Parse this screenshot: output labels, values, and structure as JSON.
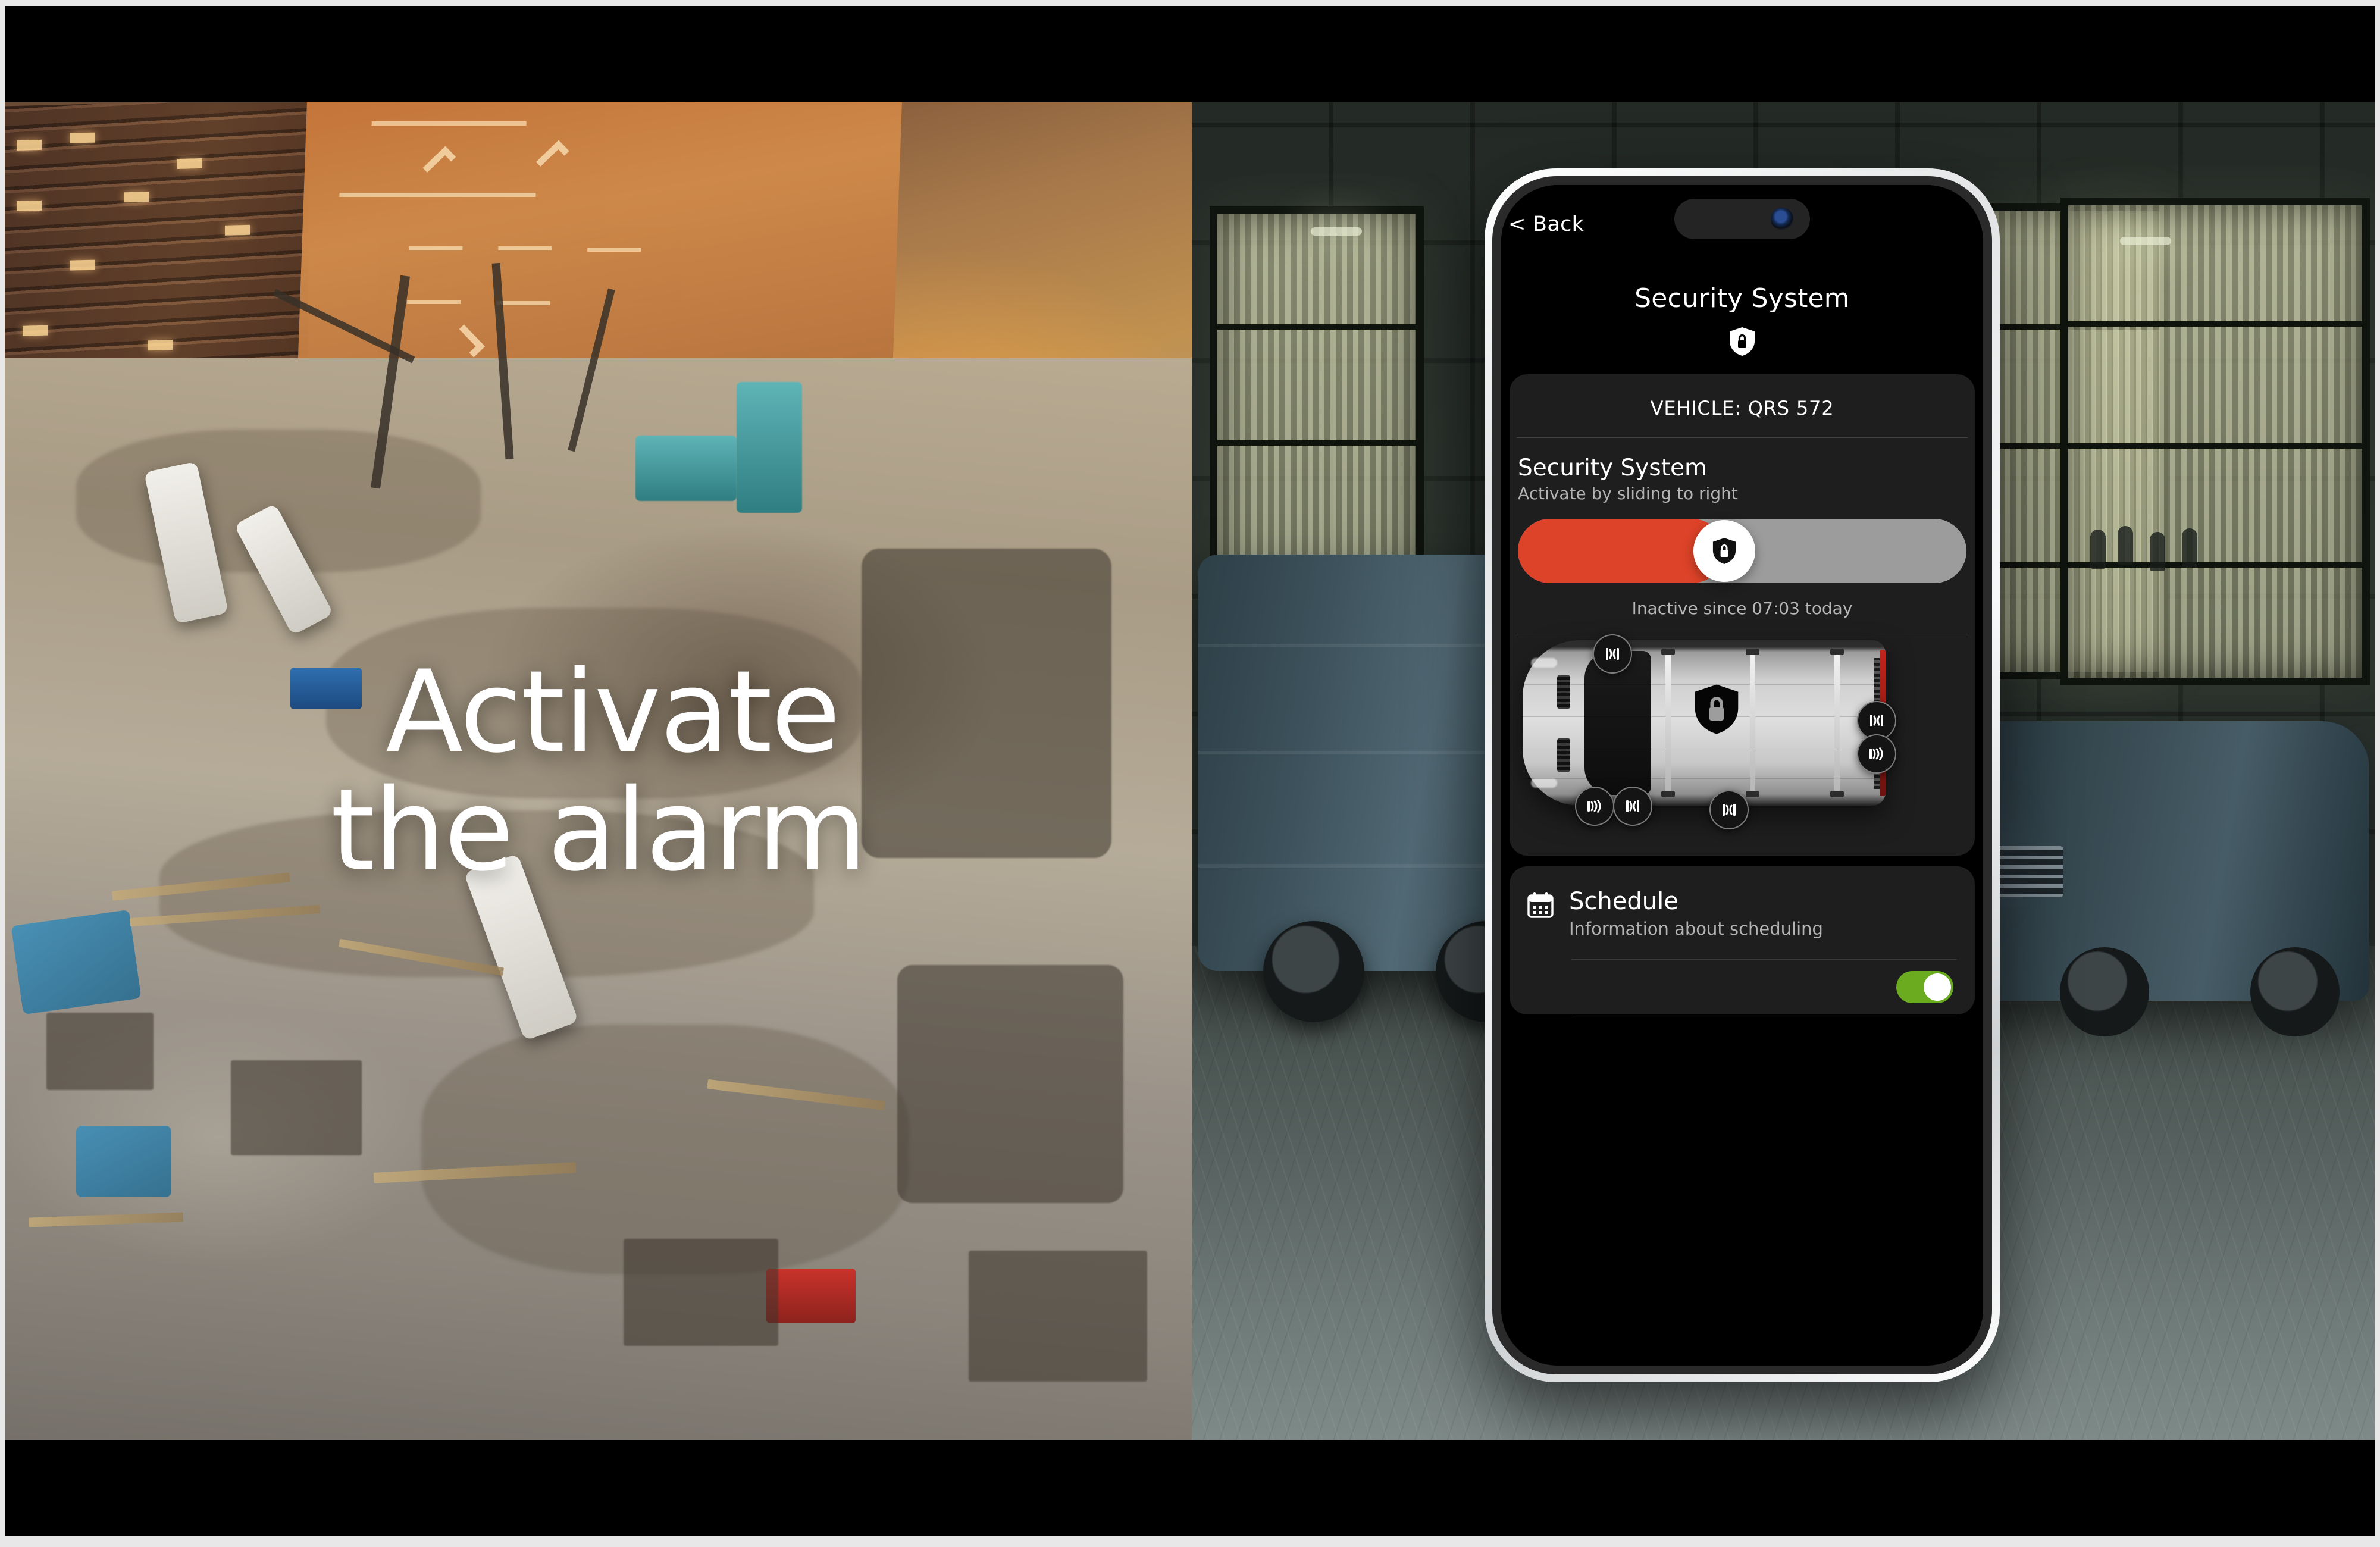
{
  "headline": {
    "line1": "Activate",
    "line2": "the alarm"
  },
  "phone": {
    "back_label": "< Back",
    "screen_title": "Security System",
    "header_icon": "shield-lock-icon",
    "island_camera_icon": "front-camera-icon"
  },
  "main_card": {
    "vehicle_label": "VEHICLE: QRS 572",
    "security": {
      "title": "Security System",
      "subtitle": "Activate by sliding to right",
      "slider": {
        "knob_icon": "shield-lock-icon",
        "fill_percent": 46,
        "fill_color": "#dd4328",
        "track_color": "#9c9c9c",
        "knob_color": "#ffffff"
      },
      "status": "Inactive since 07:03 today"
    },
    "diagram": {
      "center_icon": "shield-lock-icon",
      "sensors": [
        {
          "name": "door-sensor-front-left",
          "icon": "door-contact-sensor-icon"
        },
        {
          "name": "motion-sensor-front-left",
          "icon": "motion-sensor-icon"
        },
        {
          "name": "door-sensor-front-bottom",
          "icon": "door-contact-sensor-icon"
        },
        {
          "name": "door-sensor-cargo-bottom",
          "icon": "door-contact-sensor-icon"
        },
        {
          "name": "door-sensor-rear",
          "icon": "door-contact-sensor-icon"
        },
        {
          "name": "motion-sensor-rear",
          "icon": "motion-sensor-icon"
        }
      ]
    }
  },
  "schedule_card": {
    "icon": "calendar-icon",
    "title": "Schedule",
    "subtitle": "Information about scheduling",
    "next_row_toggle": {
      "state": "on",
      "color": "#6aab1f"
    }
  },
  "theme": {
    "accent_red": "#dd4328",
    "accent_green": "#6aab1f",
    "card_background": "#1e1e1e",
    "screen_background": "#000000",
    "text_primary": "#ffffff",
    "text_secondary": "#b3b3b3"
  }
}
